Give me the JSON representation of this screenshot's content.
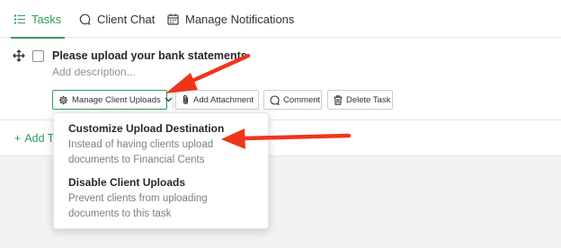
{
  "tabs": [
    {
      "label": "Tasks",
      "icon": "list-icon",
      "active": true
    },
    {
      "label": "Client Chat",
      "icon": "chat-bubble-icon",
      "active": false
    },
    {
      "label": "Manage Notifications",
      "icon": "calendar-icon",
      "active": false
    }
  ],
  "task": {
    "title": "Please upload your bank statements",
    "description_placeholder": "Add description..."
  },
  "actions": {
    "manage_uploads": "Manage Client Uploads",
    "add_attachment": "Add Attachment",
    "comment": "Comment",
    "delete_task": "Delete Task"
  },
  "add_task_label": "Add T",
  "dropdown": {
    "items": [
      {
        "title": "Customize Upload Destination",
        "description": "Instead of having clients upload documents to Financial Cents"
      },
      {
        "title": "Disable Client Uploads",
        "description": "Prevent clients from uploading documents to this task"
      }
    ]
  },
  "colors": {
    "accent": "#2f9e5a",
    "annotation_arrow": "#f0341c"
  }
}
